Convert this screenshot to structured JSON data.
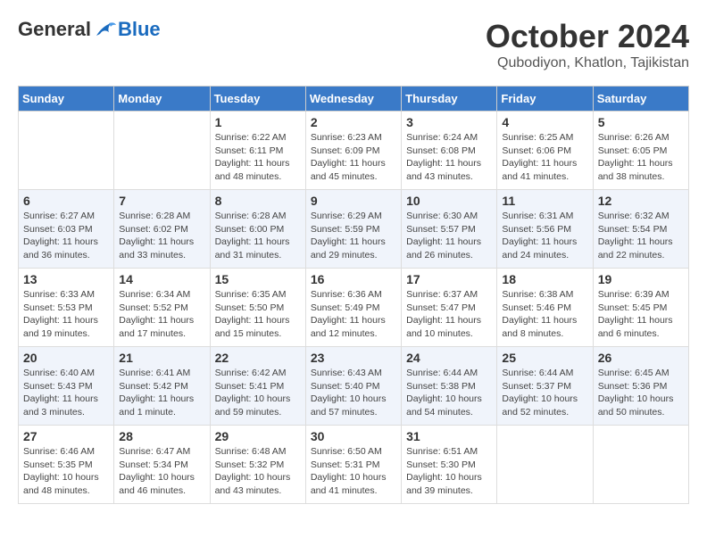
{
  "logo": {
    "general": "General",
    "blue": "Blue"
  },
  "title": "October 2024",
  "location": "Qubodiyon, Khatlon, Tajikistan",
  "days_of_week": [
    "Sunday",
    "Monday",
    "Tuesday",
    "Wednesday",
    "Thursday",
    "Friday",
    "Saturday"
  ],
  "weeks": [
    [
      {
        "day": "",
        "info": ""
      },
      {
        "day": "",
        "info": ""
      },
      {
        "day": "1",
        "info": "Sunrise: 6:22 AM\nSunset: 6:11 PM\nDaylight: 11 hours and 48 minutes."
      },
      {
        "day": "2",
        "info": "Sunrise: 6:23 AM\nSunset: 6:09 PM\nDaylight: 11 hours and 45 minutes."
      },
      {
        "day": "3",
        "info": "Sunrise: 6:24 AM\nSunset: 6:08 PM\nDaylight: 11 hours and 43 minutes."
      },
      {
        "day": "4",
        "info": "Sunrise: 6:25 AM\nSunset: 6:06 PM\nDaylight: 11 hours and 41 minutes."
      },
      {
        "day": "5",
        "info": "Sunrise: 6:26 AM\nSunset: 6:05 PM\nDaylight: 11 hours and 38 minutes."
      }
    ],
    [
      {
        "day": "6",
        "info": "Sunrise: 6:27 AM\nSunset: 6:03 PM\nDaylight: 11 hours and 36 minutes."
      },
      {
        "day": "7",
        "info": "Sunrise: 6:28 AM\nSunset: 6:02 PM\nDaylight: 11 hours and 33 minutes."
      },
      {
        "day": "8",
        "info": "Sunrise: 6:28 AM\nSunset: 6:00 PM\nDaylight: 11 hours and 31 minutes."
      },
      {
        "day": "9",
        "info": "Sunrise: 6:29 AM\nSunset: 5:59 PM\nDaylight: 11 hours and 29 minutes."
      },
      {
        "day": "10",
        "info": "Sunrise: 6:30 AM\nSunset: 5:57 PM\nDaylight: 11 hours and 26 minutes."
      },
      {
        "day": "11",
        "info": "Sunrise: 6:31 AM\nSunset: 5:56 PM\nDaylight: 11 hours and 24 minutes."
      },
      {
        "day": "12",
        "info": "Sunrise: 6:32 AM\nSunset: 5:54 PM\nDaylight: 11 hours and 22 minutes."
      }
    ],
    [
      {
        "day": "13",
        "info": "Sunrise: 6:33 AM\nSunset: 5:53 PM\nDaylight: 11 hours and 19 minutes."
      },
      {
        "day": "14",
        "info": "Sunrise: 6:34 AM\nSunset: 5:52 PM\nDaylight: 11 hours and 17 minutes."
      },
      {
        "day": "15",
        "info": "Sunrise: 6:35 AM\nSunset: 5:50 PM\nDaylight: 11 hours and 15 minutes."
      },
      {
        "day": "16",
        "info": "Sunrise: 6:36 AM\nSunset: 5:49 PM\nDaylight: 11 hours and 12 minutes."
      },
      {
        "day": "17",
        "info": "Sunrise: 6:37 AM\nSunset: 5:47 PM\nDaylight: 11 hours and 10 minutes."
      },
      {
        "day": "18",
        "info": "Sunrise: 6:38 AM\nSunset: 5:46 PM\nDaylight: 11 hours and 8 minutes."
      },
      {
        "day": "19",
        "info": "Sunrise: 6:39 AM\nSunset: 5:45 PM\nDaylight: 11 hours and 6 minutes."
      }
    ],
    [
      {
        "day": "20",
        "info": "Sunrise: 6:40 AM\nSunset: 5:43 PM\nDaylight: 11 hours and 3 minutes."
      },
      {
        "day": "21",
        "info": "Sunrise: 6:41 AM\nSunset: 5:42 PM\nDaylight: 11 hours and 1 minute."
      },
      {
        "day": "22",
        "info": "Sunrise: 6:42 AM\nSunset: 5:41 PM\nDaylight: 10 hours and 59 minutes."
      },
      {
        "day": "23",
        "info": "Sunrise: 6:43 AM\nSunset: 5:40 PM\nDaylight: 10 hours and 57 minutes."
      },
      {
        "day": "24",
        "info": "Sunrise: 6:44 AM\nSunset: 5:38 PM\nDaylight: 10 hours and 54 minutes."
      },
      {
        "day": "25",
        "info": "Sunrise: 6:44 AM\nSunset: 5:37 PM\nDaylight: 10 hours and 52 minutes."
      },
      {
        "day": "26",
        "info": "Sunrise: 6:45 AM\nSunset: 5:36 PM\nDaylight: 10 hours and 50 minutes."
      }
    ],
    [
      {
        "day": "27",
        "info": "Sunrise: 6:46 AM\nSunset: 5:35 PM\nDaylight: 10 hours and 48 minutes."
      },
      {
        "day": "28",
        "info": "Sunrise: 6:47 AM\nSunset: 5:34 PM\nDaylight: 10 hours and 46 minutes."
      },
      {
        "day": "29",
        "info": "Sunrise: 6:48 AM\nSunset: 5:32 PM\nDaylight: 10 hours and 43 minutes."
      },
      {
        "day": "30",
        "info": "Sunrise: 6:50 AM\nSunset: 5:31 PM\nDaylight: 10 hours and 41 minutes."
      },
      {
        "day": "31",
        "info": "Sunrise: 6:51 AM\nSunset: 5:30 PM\nDaylight: 10 hours and 39 minutes."
      },
      {
        "day": "",
        "info": ""
      },
      {
        "day": "",
        "info": ""
      }
    ]
  ]
}
